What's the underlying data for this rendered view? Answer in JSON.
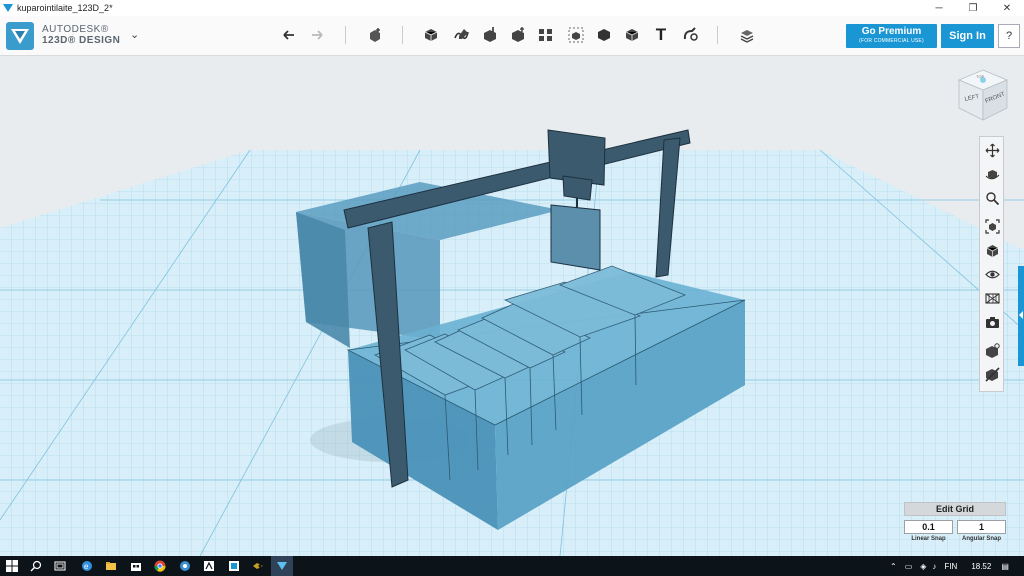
{
  "window": {
    "title": "kuparointilaite_123D_2*",
    "minimize_glyph": "─",
    "maximize_glyph": "❐",
    "close_glyph": "✕"
  },
  "brand": {
    "line1": "AUTODESK®",
    "line2": "123D® DESIGN",
    "menu_caret": "⌄"
  },
  "toolbar": {
    "icons": [
      "undo-icon",
      "redo-icon",
      "transform-icon",
      "primitives-icon",
      "sketch-icon",
      "construct-icon",
      "modify-icon",
      "pattern-icon",
      "grouping-icon",
      "combine-icon",
      "measure-icon",
      "text-icon",
      "snap-icon",
      "material-icon"
    ],
    "text_tool_glyph": "T"
  },
  "account": {
    "premium_label": "Go Premium",
    "premium_sub": "(FOR COMMERCIAL USE)",
    "signin_label": "Sign In",
    "help_label": "?"
  },
  "viewcube": {
    "left_label": "LEFT",
    "front_label": "FRONT",
    "top_label": "TOP"
  },
  "nav_panel": {
    "icons": [
      "pan-icon",
      "orbit-icon",
      "zoom-icon",
      "fit-icon",
      "view-mode-icon",
      "visibility-icon",
      "materials-icon",
      "screenshot-icon",
      "ortho-icon",
      "hide-icon"
    ]
  },
  "grid": {
    "edit_label": "Edit Grid",
    "linear_snap_value": "0.1",
    "linear_snap_label": "Linear Snap",
    "angular_snap_value": "1",
    "angular_snap_label": "Angular Snap"
  },
  "taskbar": {
    "apps": [
      "windows-start-icon",
      "search-icon",
      "task-view-icon",
      "edge-icon",
      "file-explorer-icon",
      "store-icon",
      "chrome-icon",
      "photos-icon",
      "app-icon",
      "123d-app-icon",
      "media-icon",
      "123d-design-icon"
    ],
    "language": "FIN",
    "time": "18.52"
  },
  "colors": {
    "accent": "#1b96d4",
    "model_fill": "#4a8fb3",
    "frame": "#3a5466",
    "grid_major": "#7ec6e2",
    "grid_bg": "#dbeff7"
  }
}
